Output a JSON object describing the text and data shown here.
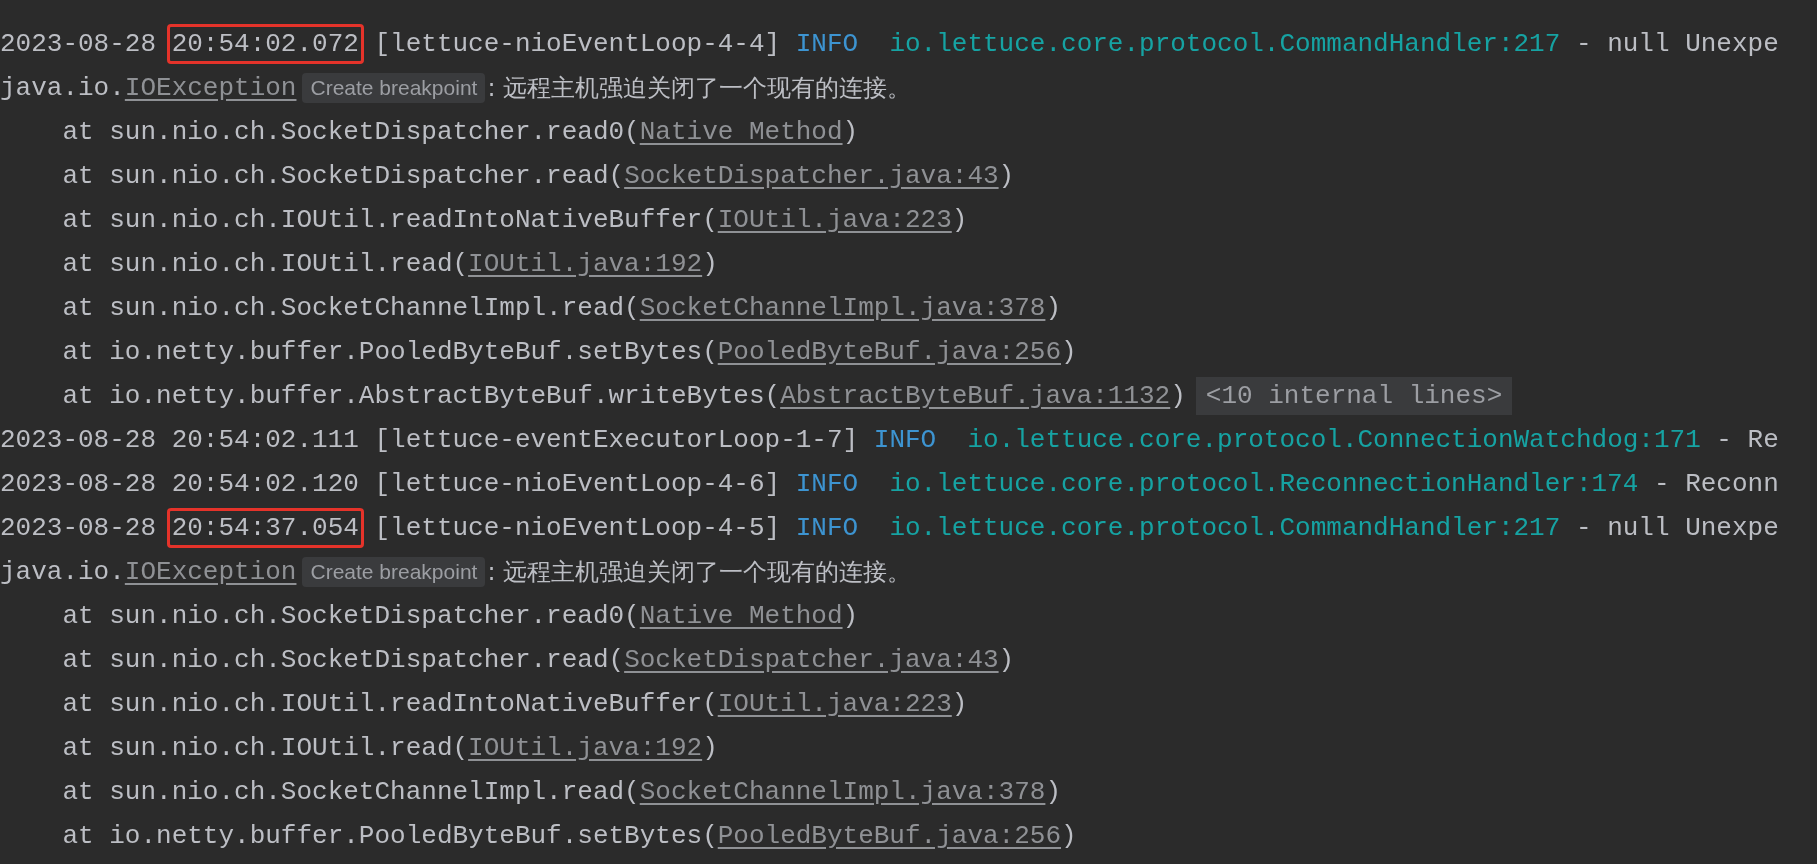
{
  "console": {
    "lines": [
      {
        "kind": "log",
        "date": "2023-08-28",
        "time": "20:54:02.072",
        "highlighted": true,
        "thread": "[lettuce-nioEventLoop-4-4]",
        "level": "INFO",
        "logger": "io.lettuce.core.protocol.CommandHandler:217",
        "message": "- null Unexpe"
      },
      {
        "kind": "exception",
        "package": "java.io.",
        "class": "IOException",
        "hint": "Create breakpoint",
        "message": ": 远程主机强迫关闭了一个现有的连接。"
      },
      {
        "kind": "frame",
        "text": "at sun.nio.ch.SocketDispatcher.read0(",
        "link": "Native Method",
        "close": ")"
      },
      {
        "kind": "frame",
        "text": "at sun.nio.ch.SocketDispatcher.read(",
        "link": "SocketDispatcher.java:43",
        "close": ")"
      },
      {
        "kind": "frame",
        "text": "at sun.nio.ch.IOUtil.readIntoNativeBuffer(",
        "link": "IOUtil.java:223",
        "close": ")"
      },
      {
        "kind": "frame",
        "text": "at sun.nio.ch.IOUtil.read(",
        "link": "IOUtil.java:192",
        "close": ")"
      },
      {
        "kind": "frame",
        "text": "at sun.nio.ch.SocketChannelImpl.read(",
        "link": "SocketChannelImpl.java:378",
        "close": ")"
      },
      {
        "kind": "frame",
        "text": "at io.netty.buffer.PooledByteBuf.setBytes(",
        "link": "PooledByteBuf.java:256",
        "close": ")"
      },
      {
        "kind": "frame",
        "text": "at io.netty.buffer.AbstractByteBuf.writeBytes(",
        "link": "AbstractByteBuf.java:1132",
        "close": ")",
        "folded": "<10 internal lines>"
      },
      {
        "kind": "log",
        "date": "2023-08-28",
        "time": "20:54:02.111",
        "highlighted": false,
        "thread": "[lettuce-eventExecutorLoop-1-7]",
        "level": "INFO",
        "logger": "io.lettuce.core.protocol.ConnectionWatchdog:171",
        "message": "- Re"
      },
      {
        "kind": "log",
        "date": "2023-08-28",
        "time": "20:54:02.120",
        "highlighted": false,
        "thread": "[lettuce-nioEventLoop-4-6]",
        "level": "INFO",
        "logger": "io.lettuce.core.protocol.ReconnectionHandler:174",
        "message": "- Reconn"
      },
      {
        "kind": "log",
        "date": "2023-08-28",
        "time": "20:54:37.054",
        "highlighted": true,
        "thread": "[lettuce-nioEventLoop-4-5]",
        "level": "INFO",
        "logger": "io.lettuce.core.protocol.CommandHandler:217",
        "message": "- null Unexpe"
      },
      {
        "kind": "exception",
        "package": "java.io.",
        "class": "IOException",
        "hint": "Create breakpoint",
        "message": ": 远程主机强迫关闭了一个现有的连接。"
      },
      {
        "kind": "frame",
        "text": "at sun.nio.ch.SocketDispatcher.read0(",
        "link": "Native Method",
        "close": ")"
      },
      {
        "kind": "frame",
        "text": "at sun.nio.ch.SocketDispatcher.read(",
        "link": "SocketDispatcher.java:43",
        "close": ")"
      },
      {
        "kind": "frame",
        "text": "at sun.nio.ch.IOUtil.readIntoNativeBuffer(",
        "link": "IOUtil.java:223",
        "close": ")"
      },
      {
        "kind": "frame",
        "text": "at sun.nio.ch.IOUtil.read(",
        "link": "IOUtil.java:192",
        "close": ")"
      },
      {
        "kind": "frame",
        "text": "at sun.nio.ch.SocketChannelImpl.read(",
        "link": "SocketChannelImpl.java:378",
        "close": ")"
      },
      {
        "kind": "frame",
        "text": "at io.netty.buffer.PooledByteBuf.setBytes(",
        "link": "PooledByteBuf.java:256",
        "close": ")"
      }
    ]
  }
}
